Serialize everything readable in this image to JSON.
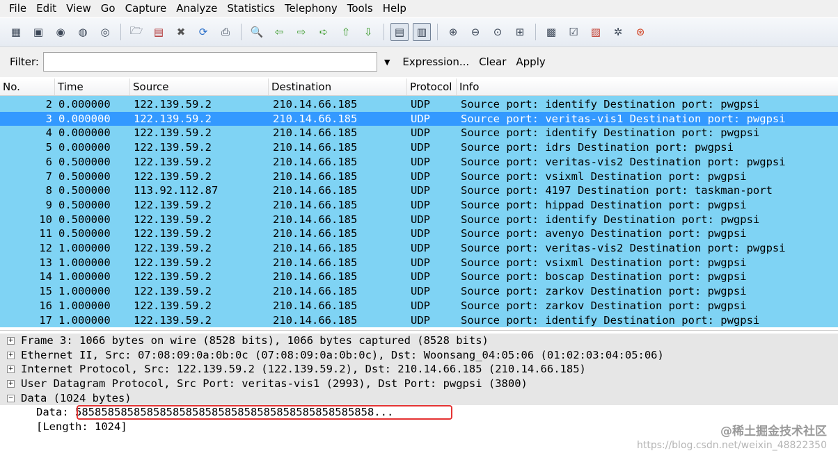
{
  "menu": [
    "File",
    "Edit",
    "View",
    "Go",
    "Capture",
    "Analyze",
    "Statistics",
    "Telephony",
    "Tools",
    "Help"
  ],
  "toolbar_icons": [
    "interfaces-icon",
    "capture-options-icon",
    "start-capture-icon",
    "stop-capture-icon",
    "restart-capture-icon",
    "open-file-icon",
    "save-file-icon",
    "close-file-icon",
    "reload-icon",
    "print-icon",
    "find-packet-icon",
    "go-back-icon",
    "go-forward-icon",
    "go-to-packet-icon",
    "go-first-icon",
    "go-last-icon",
    "colorize-icon",
    "auto-scroll-icon",
    "zoom-in-icon",
    "zoom-out-icon",
    "normal-size-icon",
    "resize-columns-icon",
    "capture-filters-icon",
    "display-filters-icon",
    "coloring-rules-icon",
    "preferences-icon",
    "help-icon"
  ],
  "filter": {
    "label": "Filter:",
    "value": "",
    "expression": "Expression...",
    "clear": "Clear",
    "apply": "Apply"
  },
  "columns": [
    "No.",
    "Time",
    "Source",
    "Destination",
    "Protocol",
    "Info"
  ],
  "selected_row": 3,
  "rows": [
    {
      "no": "2",
      "time": "0.000000",
      "src": "122.139.59.2",
      "dst": "210.14.66.185",
      "proto": "UDP",
      "info": "Source port: identify  Destination port: pwgpsi"
    },
    {
      "no": "3",
      "time": "0.000000",
      "src": "122.139.59.2",
      "dst": "210.14.66.185",
      "proto": "UDP",
      "info": "Source port: veritas-vis1  Destination port: pwgpsi"
    },
    {
      "no": "4",
      "time": "0.000000",
      "src": "122.139.59.2",
      "dst": "210.14.66.185",
      "proto": "UDP",
      "info": "Source port: identify  Destination port: pwgpsi"
    },
    {
      "no": "5",
      "time": "0.000000",
      "src": "122.139.59.2",
      "dst": "210.14.66.185",
      "proto": "UDP",
      "info": "Source port: idrs  Destination port: pwgpsi"
    },
    {
      "no": "6",
      "time": "0.500000",
      "src": "122.139.59.2",
      "dst": "210.14.66.185",
      "proto": "UDP",
      "info": "Source port: veritas-vis2  Destination port: pwgpsi"
    },
    {
      "no": "7",
      "time": "0.500000",
      "src": "122.139.59.2",
      "dst": "210.14.66.185",
      "proto": "UDP",
      "info": "Source port: vsixml  Destination port: pwgpsi"
    },
    {
      "no": "8",
      "time": "0.500000",
      "src": "113.92.112.87",
      "dst": "210.14.66.185",
      "proto": "UDP",
      "info": "Source port: 4197  Destination port: taskman-port"
    },
    {
      "no": "9",
      "time": "0.500000",
      "src": "122.139.59.2",
      "dst": "210.14.66.185",
      "proto": "UDP",
      "info": "Source port: hippad  Destination port: pwgpsi"
    },
    {
      "no": "10",
      "time": "0.500000",
      "src": "122.139.59.2",
      "dst": "210.14.66.185",
      "proto": "UDP",
      "info": "Source port: identify  Destination port: pwgpsi"
    },
    {
      "no": "11",
      "time": "0.500000",
      "src": "122.139.59.2",
      "dst": "210.14.66.185",
      "proto": "UDP",
      "info": "Source port: avenyo  Destination port: pwgpsi"
    },
    {
      "no": "12",
      "time": "1.000000",
      "src": "122.139.59.2",
      "dst": "210.14.66.185",
      "proto": "UDP",
      "info": "Source port: veritas-vis2  Destination port: pwgpsi"
    },
    {
      "no": "13",
      "time": "1.000000",
      "src": "122.139.59.2",
      "dst": "210.14.66.185",
      "proto": "UDP",
      "info": "Source port: vsixml  Destination port: pwgpsi"
    },
    {
      "no": "14",
      "time": "1.000000",
      "src": "122.139.59.2",
      "dst": "210.14.66.185",
      "proto": "UDP",
      "info": "Source port: boscap  Destination port: pwgpsi"
    },
    {
      "no": "15",
      "time": "1.000000",
      "src": "122.139.59.2",
      "dst": "210.14.66.185",
      "proto": "UDP",
      "info": "Source port: zarkov  Destination port: pwgpsi"
    },
    {
      "no": "16",
      "time": "1.000000",
      "src": "122.139.59.2",
      "dst": "210.14.66.185",
      "proto": "UDP",
      "info": "Source port: zarkov  Destination port: pwgpsi"
    },
    {
      "no": "17",
      "time": "1.000000",
      "src": "122.139.59.2",
      "dst": "210.14.66.185",
      "proto": "UDP",
      "info": "Source port: identify  Destination port: pwgpsi"
    }
  ],
  "details": [
    {
      "expander": "⊞",
      "text": "Frame 3: 1066 bytes on wire (8528 bits), 1066 bytes captured (8528 bits)"
    },
    {
      "expander": "⊞",
      "text": "Ethernet II, Src: 07:08:09:0a:0b:0c (07:08:09:0a:0b:0c), Dst: Woonsang_04:05:06 (01:02:03:04:05:06)"
    },
    {
      "expander": "⊞",
      "text": "Internet Protocol, Src: 122.139.59.2 (122.139.59.2), Dst: 210.14.66.185 (210.14.66.185)"
    },
    {
      "expander": "⊞",
      "text": "User Datagram Protocol, Src Port: veritas-vis1 (2993), Dst Port: pwgpsi (3800)"
    },
    {
      "expander": "⊟",
      "text": "Data (1024 bytes)"
    }
  ],
  "data_fields": {
    "data_label": "Data:",
    "data_value": "5858585858585858585858585858585858585858585858...",
    "length": "[Length: 1024]"
  },
  "watermark": {
    "line1": "@稀土掘金技术社区",
    "line2": "https://blog.csdn.net/weixin_48822350"
  },
  "colors": {
    "row_bg": "#7fd3f4",
    "selected_bg": "#3399ff",
    "highlight_box": "#e53333"
  }
}
